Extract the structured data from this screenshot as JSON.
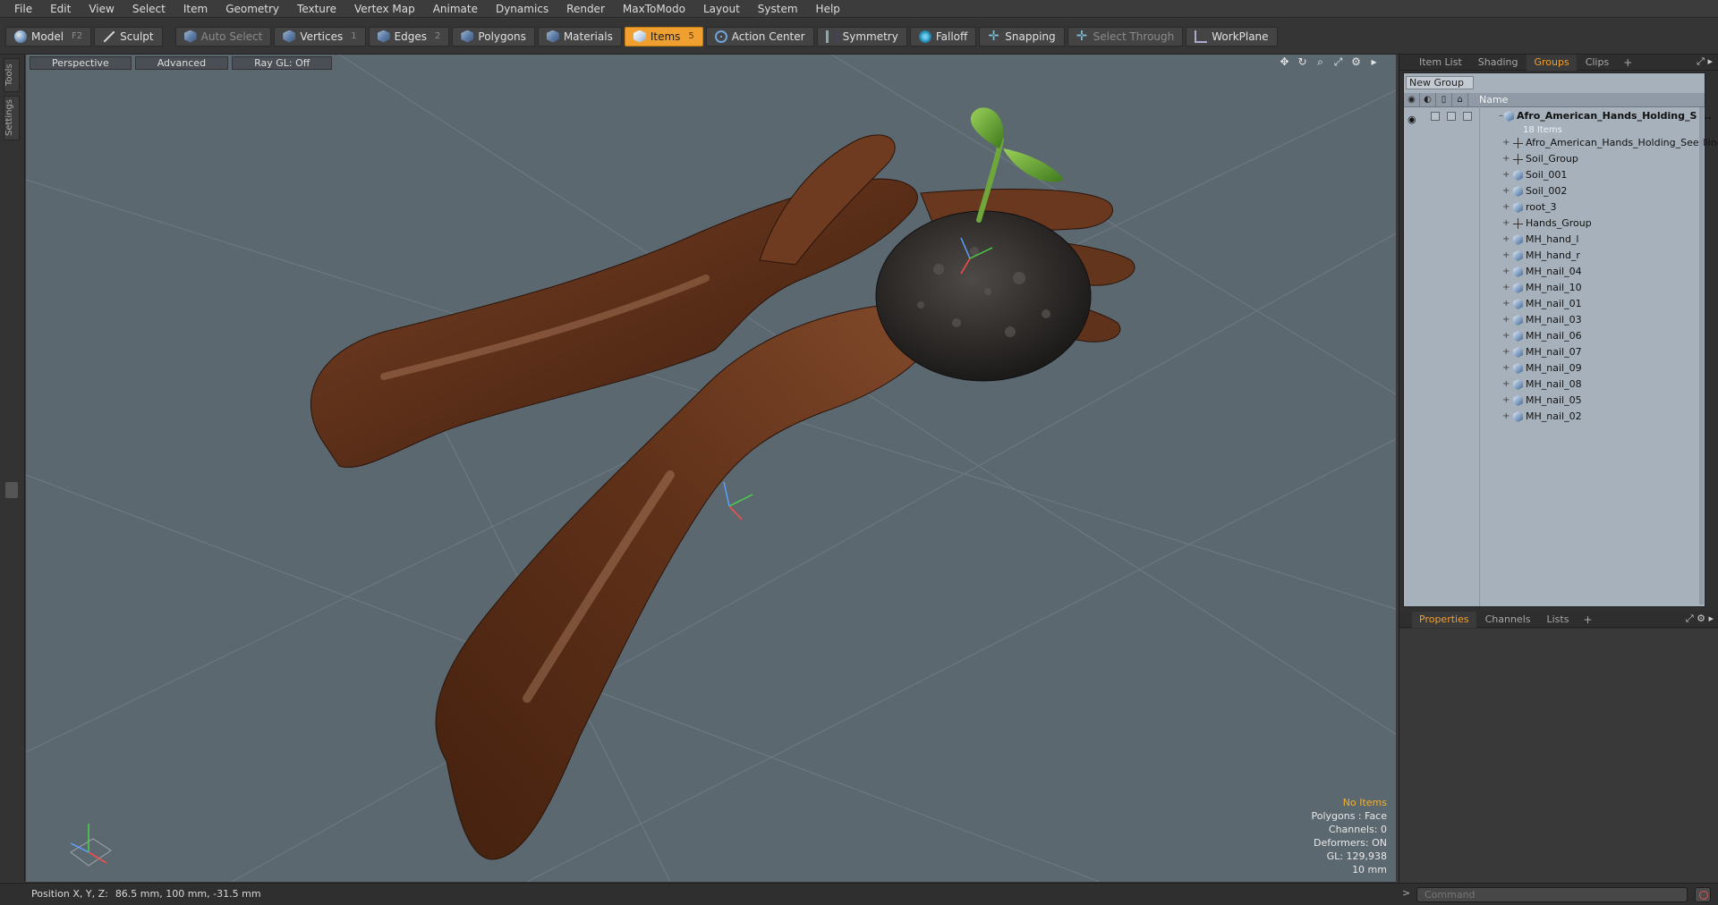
{
  "menu": [
    "File",
    "Edit",
    "View",
    "Select",
    "Item",
    "Geometry",
    "Texture",
    "Vertex Map",
    "Animate",
    "Dynamics",
    "Render",
    "MaxToModo",
    "Layout",
    "System",
    "Help"
  ],
  "toolbar": {
    "model": "Model",
    "model_key": "F2",
    "sculpt": "Sculpt",
    "auto_select": "Auto Select",
    "vertices": "Vertices",
    "vertices_key": "1",
    "edges": "Edges",
    "edges_key": "2",
    "polygons": "Polygons",
    "materials": "Materials",
    "items": "Items",
    "items_key": "5",
    "action_center": "Action Center",
    "symmetry": "Symmetry",
    "falloff": "Falloff",
    "snapping": "Snapping",
    "select_through": "Select Through",
    "workplane": "WorkPlane",
    "active_color": "#f0a030"
  },
  "left_tabs": {
    "tools": "Tools",
    "settings": "Settings"
  },
  "viewport": {
    "tabs": [
      "Perspective",
      "Advanced",
      "Ray GL: Off"
    ],
    "background_color": "#5c6870",
    "info": {
      "selection": "No Items",
      "polygons": "Polygons : Face",
      "channels": "Channels: 0",
      "deformers": "Deformers: ON",
      "gl": "GL: 129,938",
      "unit": "10 mm"
    }
  },
  "right_panel": {
    "top_tabs": [
      "Item List",
      "Shading",
      "Groups",
      "Clips"
    ],
    "active_top_tab": "Groups",
    "new_group": "New Group",
    "name_header": "Name",
    "root_group": {
      "label": "Afro_American_Hands_Holding_S ...",
      "count": "18 Items"
    },
    "items": [
      {
        "label": "Afro_American_Hands_Holding_Seedling",
        "icon": "locator-icon"
      },
      {
        "label": "Soil_Group",
        "icon": "locator-icon"
      },
      {
        "label": "Soil_001",
        "icon": "mesh-icon"
      },
      {
        "label": "Soil_002",
        "icon": "mesh-icon"
      },
      {
        "label": "root_3",
        "icon": "mesh-icon"
      },
      {
        "label": "Hands_Group",
        "icon": "locator-icon"
      },
      {
        "label": "MH_hand_l",
        "icon": "mesh-icon"
      },
      {
        "label": "MH_hand_r",
        "icon": "mesh-icon"
      },
      {
        "label": "MH_nail_04",
        "icon": "mesh-icon"
      },
      {
        "label": "MH_nail_10",
        "icon": "mesh-icon"
      },
      {
        "label": "MH_nail_01",
        "icon": "mesh-icon"
      },
      {
        "label": "MH_nail_03",
        "icon": "mesh-icon"
      },
      {
        "label": "MH_nail_06",
        "icon": "mesh-icon"
      },
      {
        "label": "MH_nail_07",
        "icon": "mesh-icon"
      },
      {
        "label": "MH_nail_09",
        "icon": "mesh-icon"
      },
      {
        "label": "MH_nail_08",
        "icon": "mesh-icon"
      },
      {
        "label": "MH_nail_05",
        "icon": "mesh-icon"
      },
      {
        "label": "MH_nail_02",
        "icon": "mesh-icon"
      }
    ],
    "bottom_tabs": [
      "Properties",
      "Channels",
      "Lists"
    ],
    "active_bottom_tab": "Properties"
  },
  "status": {
    "position_label": "Position X, Y, Z:",
    "position_value": "86.5 mm, 100 mm, -31.5 mm",
    "command_placeholder": "Command"
  }
}
